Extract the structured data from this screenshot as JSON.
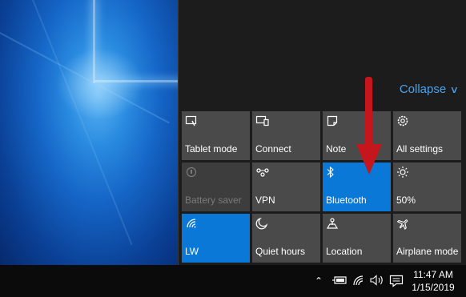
{
  "action_center": {
    "collapse_label": "Collapse",
    "tiles": [
      {
        "label": "Tablet mode",
        "icon": "tablet-mode-icon",
        "state": "off"
      },
      {
        "label": "Connect",
        "icon": "connect-icon",
        "state": "off"
      },
      {
        "label": "Note",
        "icon": "note-icon",
        "state": "off"
      },
      {
        "label": "All settings",
        "icon": "gear-icon",
        "state": "off"
      },
      {
        "label": "Battery saver",
        "icon": "battery-saver-icon",
        "state": "disabled"
      },
      {
        "label": "VPN",
        "icon": "vpn-icon",
        "state": "off"
      },
      {
        "label": "Bluetooth",
        "icon": "bluetooth-icon",
        "state": "on"
      },
      {
        "label": "50%",
        "icon": "brightness-icon",
        "state": "off"
      },
      {
        "label": "LW",
        "icon": "wifi-icon",
        "state": "on"
      },
      {
        "label": "Quiet hours",
        "icon": "moon-icon",
        "state": "off"
      },
      {
        "label": "Location",
        "icon": "location-icon",
        "state": "off"
      },
      {
        "label": "Airplane mode",
        "icon": "airplane-icon",
        "state": "off"
      }
    ]
  },
  "taskbar": {
    "time": "11:47 AM",
    "date": "1/15/2019"
  },
  "colors": {
    "accent": "#0a78d7",
    "tile": "#4a4a4a",
    "link": "#4aa3ee",
    "annotation_arrow": "#c4161c"
  }
}
